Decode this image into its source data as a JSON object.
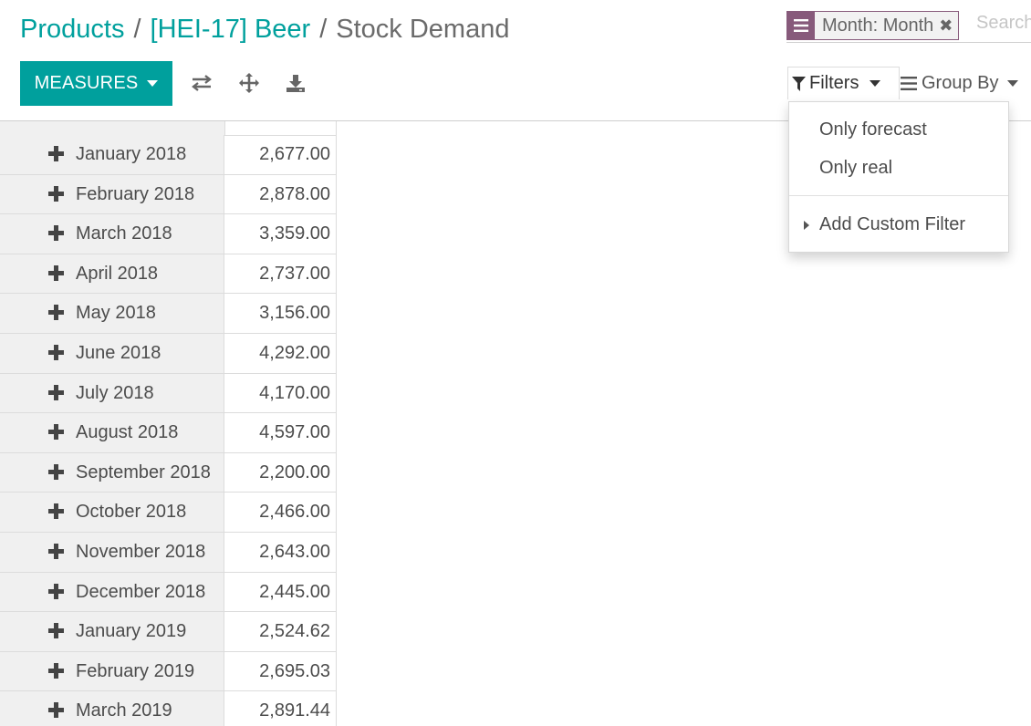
{
  "breadcrumb": {
    "items": [
      "Products",
      "[HEI-17] Beer"
    ],
    "separator": "/",
    "current": "Stock Demand"
  },
  "search": {
    "facet_label": "Month: Month",
    "facet_icon": "list-icon",
    "placeholder": "Search..."
  },
  "toolbar": {
    "measures_label": "MEASURES",
    "icons": [
      "swap-axes-icon",
      "expand-all-icon",
      "download-icon"
    ]
  },
  "filters": {
    "filters_label": "Filters",
    "groupby_label": "Group By",
    "menu_items": [
      "Only forecast",
      "Only real"
    ],
    "custom_filter_label": "Add Custom Filter"
  },
  "pivot": {
    "rows": [
      {
        "label": "January 2018",
        "value": "2,677.00"
      },
      {
        "label": "February 2018",
        "value": "2,878.00"
      },
      {
        "label": "March 2018",
        "value": "3,359.00"
      },
      {
        "label": "April 2018",
        "value": "2,737.00"
      },
      {
        "label": "May 2018",
        "value": "3,156.00"
      },
      {
        "label": "June 2018",
        "value": "4,292.00"
      },
      {
        "label": "July 2018",
        "value": "4,170.00"
      },
      {
        "label": "August 2018",
        "value": "4,597.00"
      },
      {
        "label": "September 2018",
        "value": "2,200.00"
      },
      {
        "label": "October 2018",
        "value": "2,466.00"
      },
      {
        "label": "November 2018",
        "value": "2,643.00"
      },
      {
        "label": "December 2018",
        "value": "2,445.00"
      },
      {
        "label": "January 2019",
        "value": "2,524.62"
      },
      {
        "label": "February 2019",
        "value": "2,695.03"
      },
      {
        "label": "March 2019",
        "value": "2,891.44"
      }
    ]
  },
  "colors": {
    "primary": "#00a09d",
    "facet": "#875a7b"
  }
}
